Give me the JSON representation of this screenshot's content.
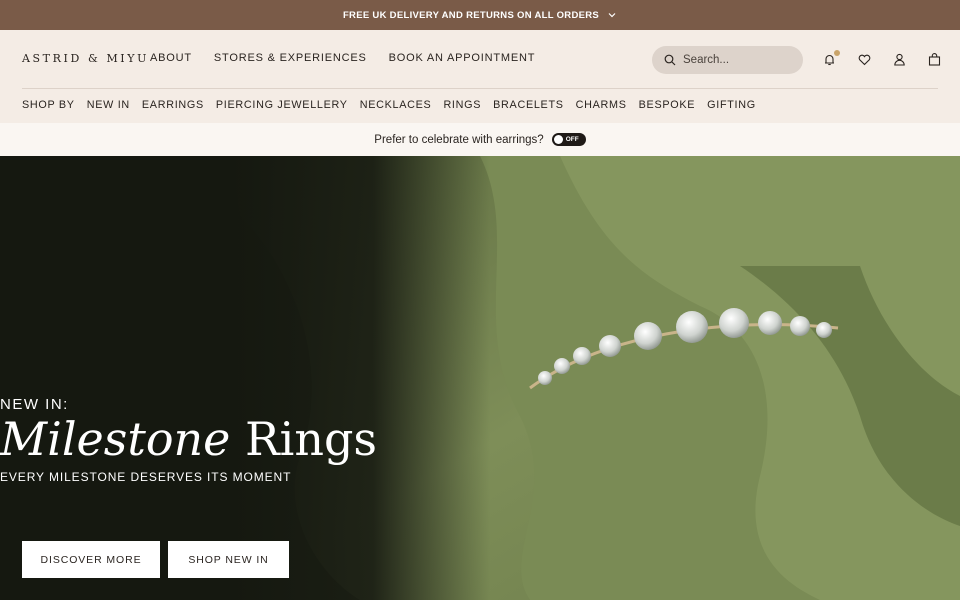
{
  "promo": {
    "text": "FREE UK DELIVERY AND RETURNS ON ALL ORDERS",
    "icon": "chevron-down-icon"
  },
  "brand": {
    "logo": "ASTRID & MIYU"
  },
  "topnav": [
    "ABOUT",
    "STORES & EXPERIENCES",
    "BOOK AN APPOINTMENT"
  ],
  "search": {
    "placeholder": "Search..."
  },
  "header_icons": [
    "bell-icon",
    "heart-icon",
    "user-icon",
    "bag-icon"
  ],
  "categories": [
    "SHOP BY",
    "NEW IN",
    "EARRINGS",
    "PIERCING JEWELLERY",
    "NECKLACES",
    "RINGS",
    "BRACELETS",
    "CHARMS",
    "BESPOKE",
    "GIFTING"
  ],
  "toggle": {
    "label": "Prefer to celebrate with earrings?",
    "state": "OFF"
  },
  "hero": {
    "eyebrow": "NEW IN:",
    "title_italic": "Milestone",
    "title_regular": "Rings",
    "subtitle": "EVERY MILESTONE DESERVES ITS MOMENT",
    "buttons": {
      "discover": "DISCOVER MORE",
      "shop": "SHOP NEW IN"
    }
  },
  "colors": {
    "promo_bg": "#7a5b48",
    "header_bg": "#f4ece5",
    "hero_dark": "#151810",
    "fabric_green": "#7e8e58"
  }
}
